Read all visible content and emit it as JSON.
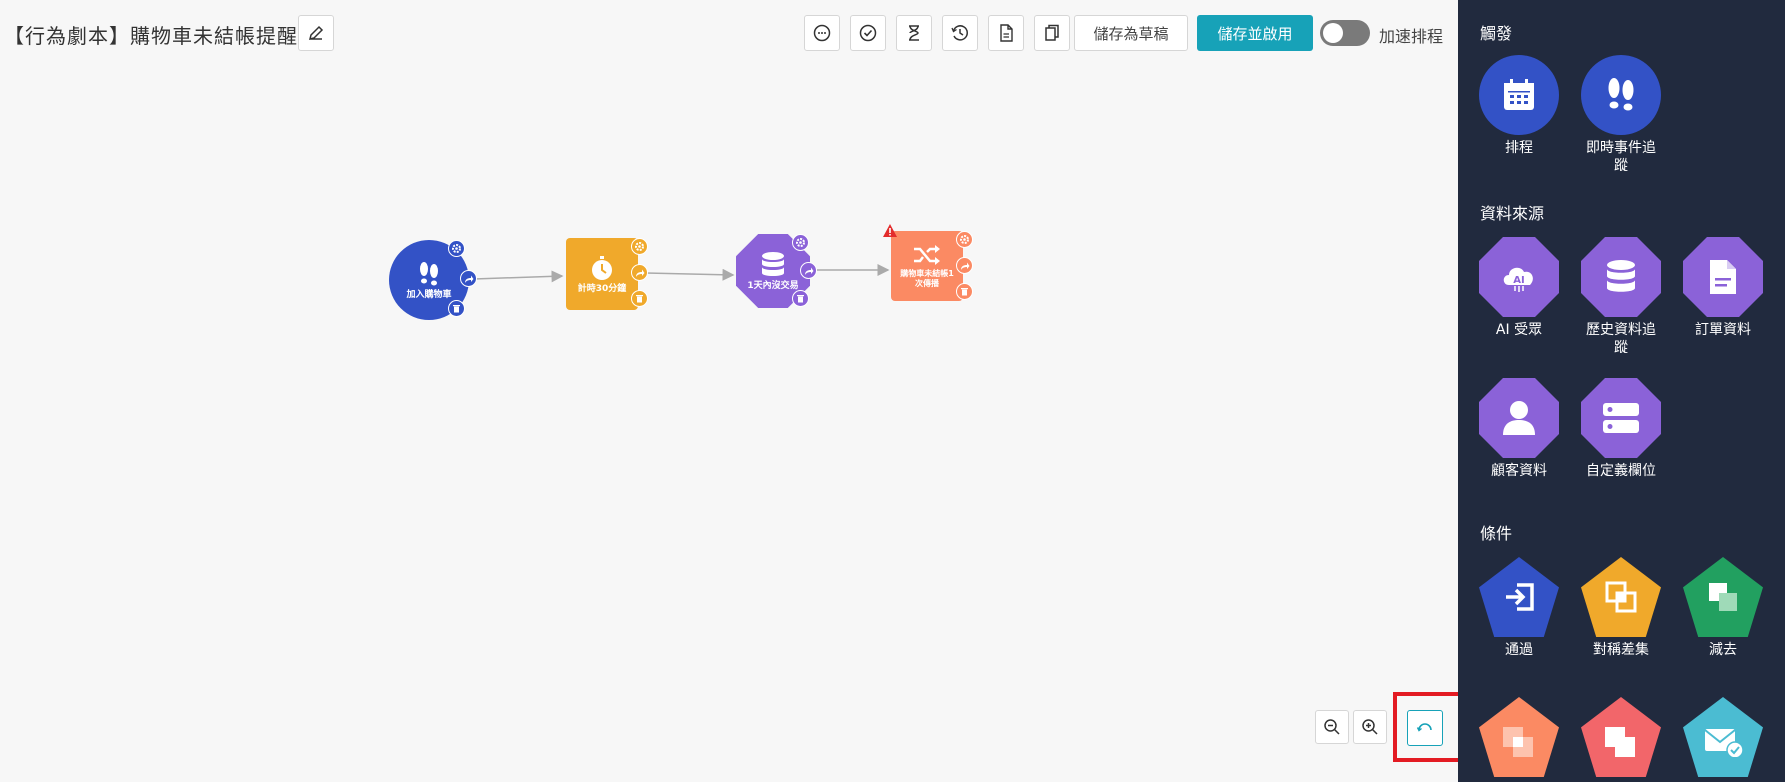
{
  "header": {
    "title": "【行為劇本】購物車未結帳提醒",
    "draft_label": "儲存為草稿",
    "save_label": "儲存並啟用",
    "toggle_label": "加速排程"
  },
  "flow_nodes": [
    {
      "label": "加入購物車",
      "color": "#3352c6"
    },
    {
      "label": "計時30分鐘",
      "color": "#f0a92b"
    },
    {
      "label": "1天內沒交易",
      "color": "#8b62d8"
    },
    {
      "label": "購物車未結帳1次傳播",
      "color": "#fb8a63"
    }
  ],
  "sidebar": {
    "sections": [
      {
        "title": "觸發",
        "items": [
          {
            "label": "排程",
            "icon": "calendar-icon",
            "color": "#3352c6"
          },
          {
            "label": "即時事件追蹤",
            "icon": "footprints-icon",
            "color": "#3352c6"
          }
        ]
      },
      {
        "title": "資料來源",
        "items": [
          {
            "label": "AI 受眾",
            "icon": "ai-cloud-icon",
            "color": "#8b62d8"
          },
          {
            "label": "歷史資料追蹤",
            "icon": "database-icon",
            "color": "#8b62d8"
          },
          {
            "label": "訂單資料",
            "icon": "document-icon",
            "color": "#8b62d8"
          },
          {
            "label": "顧客資料",
            "icon": "person-icon",
            "color": "#8b62d8"
          },
          {
            "label": "自定義欄位",
            "icon": "server-icon",
            "color": "#8b62d8"
          }
        ]
      },
      {
        "title": "條件",
        "items": [
          {
            "label": "通過",
            "icon": "enter-icon",
            "color": "#3352c6"
          },
          {
            "label": "對稱差集",
            "icon": "symmetric-diff-icon",
            "color": "#f0a92b"
          },
          {
            "label": "減去",
            "icon": "subtract-icon",
            "color": "#22a060"
          },
          {
            "label": "",
            "icon": "intersect-icon",
            "color": "#fb8a63"
          },
          {
            "label": "",
            "icon": "union-icon",
            "color": "#f2666a"
          },
          {
            "label": "",
            "icon": "mail-check-icon",
            "color": "#4bbcd2"
          }
        ]
      }
    ]
  }
}
